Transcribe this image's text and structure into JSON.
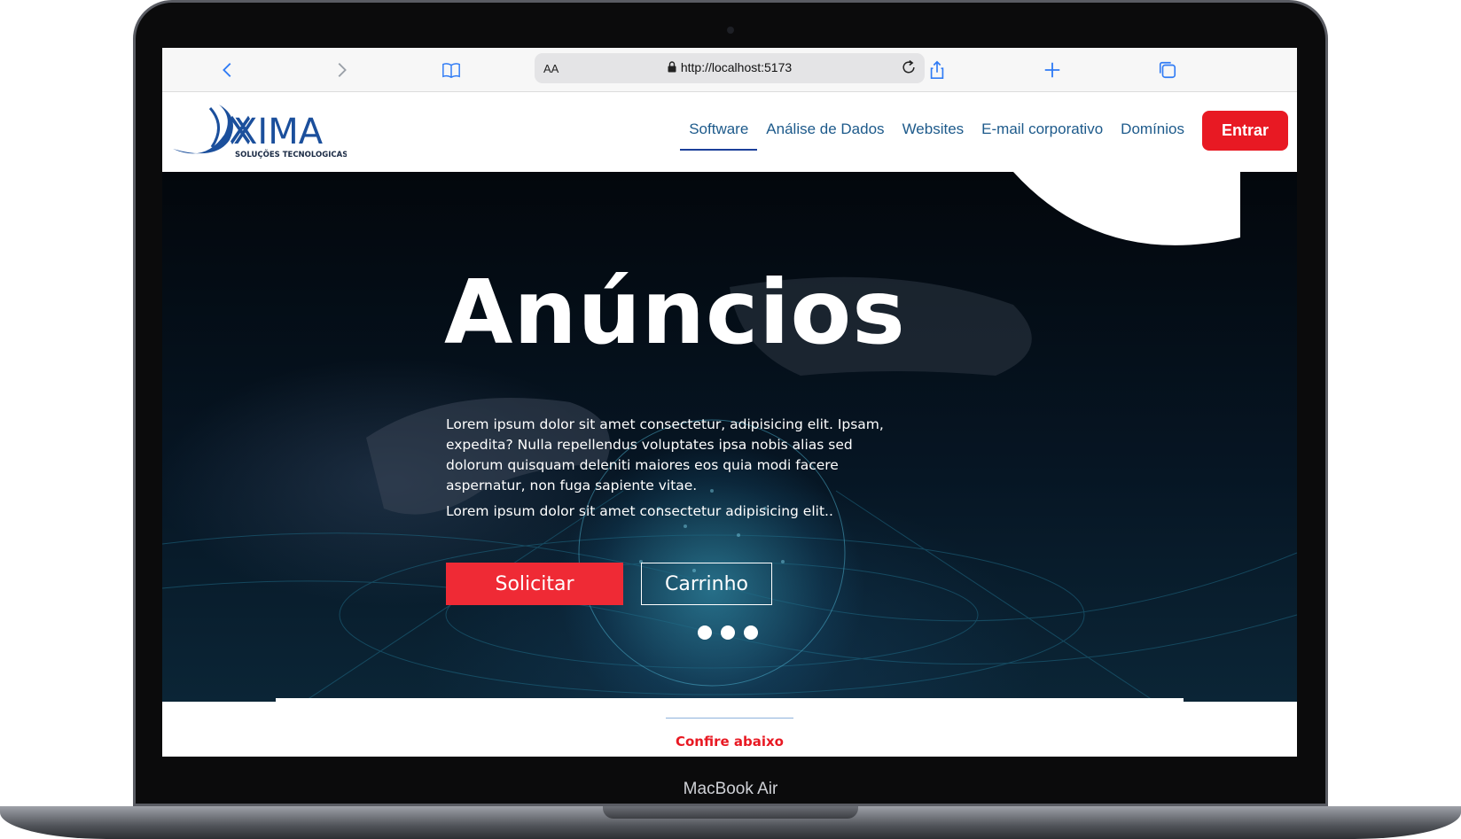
{
  "device": {
    "model_label": "MacBook Air"
  },
  "browser": {
    "text_size_label": "AA",
    "url": "http://localhost:5173",
    "icons": [
      "back-icon",
      "forward-icon",
      "bookmarks-icon",
      "lock-icon",
      "reload-icon",
      "share-icon",
      "new-tab-icon",
      "tabs-icon"
    ],
    "accent_color": "#2f7bf5"
  },
  "site": {
    "logo": {
      "brand": "XIMA",
      "tagline": "SOLUÇÕES TECNOLOGICAS"
    },
    "nav": {
      "items": [
        "Software",
        "Análise de Dados",
        "Websites",
        "E-mail corporativo",
        "Domínios"
      ],
      "active_item": "Software",
      "login_label": "Entrar"
    },
    "hero": {
      "title": "Anúncios",
      "paragraph": "Lorem ipsum dolor sit amet consectetur, adipisicing elit. Ipsam, expedita? Nulla repellendus voluptates ipsa nobis alias sed dolorum quisquam deleniti maiores eos quia modi facere aspernatur, non fuga sapiente vitae.",
      "subtext": "Lorem ipsum dolor sit amet consectetur adipisicing elit..",
      "primary_button": "Solicitar",
      "secondary_button": "Carrinho",
      "slide_count": 3
    },
    "section": {
      "heading": "Confire abaixo"
    },
    "colors": {
      "primary_red": "#e81923",
      "nav_blue": "#1d5a8b",
      "brand_blue": "#1b4f9c"
    }
  }
}
